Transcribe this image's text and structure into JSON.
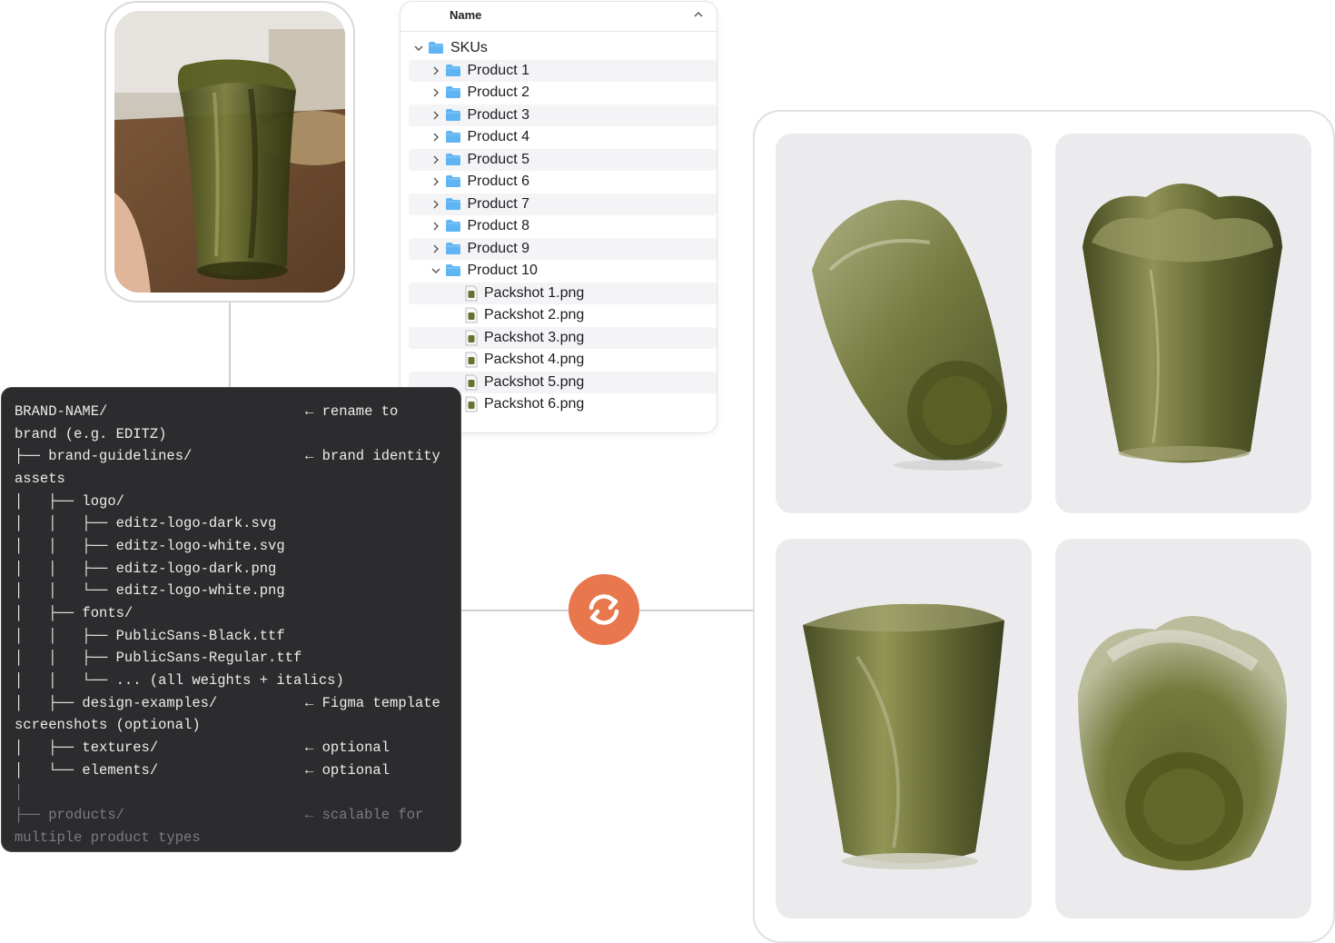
{
  "finder": {
    "header": "Name",
    "root": "SKUs",
    "folders": [
      "Product 1",
      "Product 2",
      "Product 3",
      "Product 4",
      "Product 5",
      "Product 6",
      "Product 7",
      "Product 8",
      "Product 9",
      "Product 10"
    ],
    "files": [
      "Packshot 1.png",
      "Packshot 2.png",
      "Packshot 3.png",
      "Packshot 4.png",
      "Packshot 5.png",
      "Packshot 6.png"
    ]
  },
  "terminal": {
    "lines": [
      "BRAND-NAME/",
      "brand (e.g. EDITZ)",
      "├── brand-guidelines/",
      "assets",
      "│   ├── logo/",
      "│   │   ├── editz-logo-dark.svg",
      "│   │   ├── editz-logo-white.svg",
      "│   │   ├── editz-logo-dark.png",
      "│   │   └── editz-logo-white.png",
      "│   ├── fonts/",
      "│   │   ├── PublicSans-Black.ttf",
      "│   │   ├── PublicSans-Regular.ttf",
      "│   │   └── ... (all weights + italics)",
      "│   ├── design-examples/",
      "screenshots (optional)",
      "│   ├── textures/",
      "│   └── elements/",
      "│",
      "├── products/",
      "multiple product types"
    ],
    "comments": {
      "rename": "← rename to",
      "identity": "← brand identity",
      "figma": "← Figma template",
      "optional1": "← optional",
      "optional2": "← optional",
      "scalable": "← scalable for"
    }
  },
  "icons": {
    "sync": "sync-arrows-icon",
    "folder": "folder-icon",
    "file": "image-file-icon"
  },
  "colors": {
    "accent": "#e8774e",
    "folder": "#5fb4f4",
    "glass": "#5b6228",
    "terminal_bg": "#2c2c2e"
  }
}
